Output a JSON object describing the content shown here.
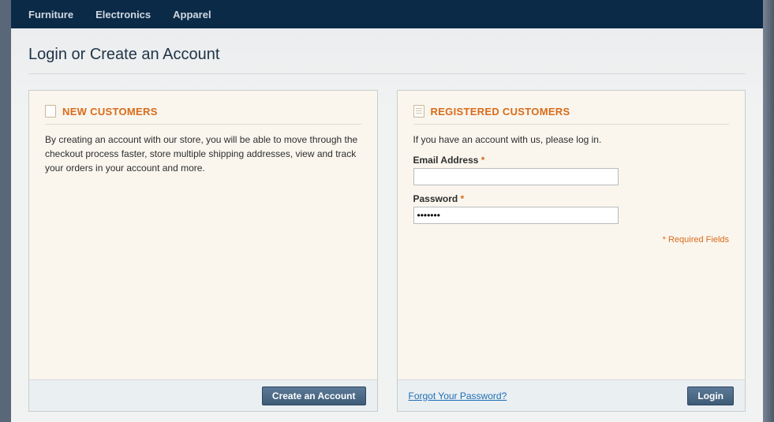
{
  "nav": {
    "items": [
      "Furniture",
      "Electronics",
      "Apparel"
    ]
  },
  "page_title": "Login or Create an Account",
  "new_customers": {
    "heading": "NEW CUSTOMERS",
    "description": "By creating an account with our store, you will be able to move through the checkout process faster, store multiple shipping addresses, view and track your orders in your account and more.",
    "create_button": "Create an Account"
  },
  "registered": {
    "heading": "REGISTERED CUSTOMERS",
    "intro": "If you have an account with us, please log in.",
    "email_label": "Email Address",
    "email_value": "",
    "password_label": "Password",
    "password_value": "•••••••",
    "required_note": "* Required Fields",
    "forgot_link": "Forgot Your Password?",
    "login_button": "Login",
    "asterisk": "*"
  }
}
